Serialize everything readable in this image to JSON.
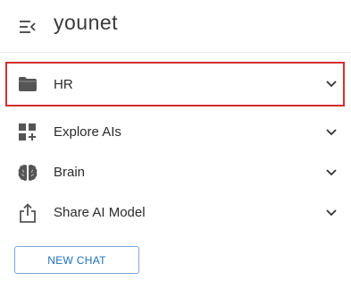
{
  "header": {
    "brand": "younet",
    "collapse_icon": "menu-collapse-icon"
  },
  "nav": {
    "items": [
      {
        "label": "HR",
        "icon": "folder-icon",
        "selected": true
      },
      {
        "label": "Explore AIs",
        "icon": "grid-add-icon",
        "selected": false
      },
      {
        "label": "Brain",
        "icon": "brain-icon",
        "selected": false
      },
      {
        "label": "Share AI Model",
        "icon": "share-icon",
        "selected": false
      }
    ]
  },
  "actions": {
    "new_chat_label": "NEW CHAT"
  },
  "colors": {
    "selection_border": "#d32f2f",
    "button_border": "#7aa7d6",
    "button_text": "#1f6fb8",
    "icon": "#555555"
  }
}
